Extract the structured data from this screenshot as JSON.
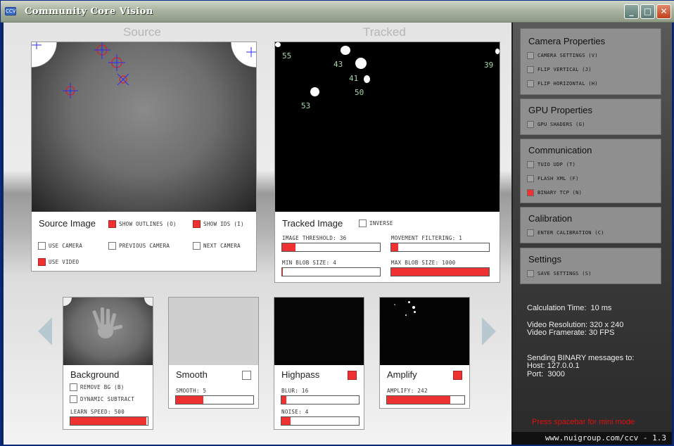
{
  "window": {
    "title": "Community Core Vision",
    "app_icon_text": "CCV",
    "buttons": {
      "minimize": "_",
      "maximize": "□",
      "close": "✕"
    }
  },
  "columns": {
    "source": "Source",
    "tracked": "Tracked"
  },
  "source_panel": {
    "title": "Source Image",
    "show_outlines": {
      "label": "Show Outlines (O)",
      "checked": true
    },
    "show_ids": {
      "label": "Show IDs (I)",
      "checked": true
    },
    "use_camera": {
      "label": "Use Camera",
      "checked": false
    },
    "previous_camera": {
      "label": "Previous Camera",
      "checked": false
    },
    "next_camera": {
      "label": "Next Camera",
      "checked": false
    },
    "use_video": {
      "label": "Use Video",
      "checked": true
    }
  },
  "tracked_panel": {
    "title": "Tracked Image",
    "inverse": {
      "label": "Inverse",
      "checked": false
    },
    "blob_ids": [
      "55",
      "43",
      "41",
      "50",
      "53",
      "39"
    ],
    "sliders": {
      "image_threshold": {
        "label": "Image Threshold: 36",
        "fraction": 0.14
      },
      "movement_filtering": {
        "label": "Movement Filtering: 1",
        "fraction": 0.07
      },
      "min_blob_size": {
        "label": "Min Blob Size: 4",
        "fraction": 0.01
      },
      "max_blob_size": {
        "label": "Max Blob Size: 1000",
        "fraction": 1.0
      }
    }
  },
  "filters": {
    "background": {
      "title": "Background",
      "remove_bg": {
        "label": "Remove BG (B)",
        "checked": false
      },
      "dynamic_subtract": {
        "label": "Dynamic Subtract",
        "checked": false
      },
      "learn_speed": {
        "label": "Learn Speed: 500",
        "fraction": 0.98
      }
    },
    "smooth": {
      "title": "Smooth",
      "enabled": false,
      "smooth": {
        "label": "Smooth: 5",
        "fraction": 0.35
      }
    },
    "highpass": {
      "title": "Highpass",
      "enabled": true,
      "blur": {
        "label": "Blur: 16",
        "fraction": 0.06
      },
      "noise": {
        "label": "Noise: 4",
        "fraction": 0.12
      }
    },
    "amplify": {
      "title": "Amplify",
      "enabled": true,
      "amplify": {
        "label": "Amplify: 242",
        "fraction": 0.82
      }
    }
  },
  "sidebar": {
    "camera": {
      "title": "Camera Properties",
      "items": [
        {
          "label": "Camera Settings (V)",
          "checked": false
        },
        {
          "label": "Flip Vertical (J)",
          "checked": false
        },
        {
          "label": "Flip Horizontal (H)",
          "checked": false
        }
      ]
    },
    "gpu": {
      "title": "GPU Properties",
      "items": [
        {
          "label": "GPU Shaders (G)",
          "checked": false
        }
      ]
    },
    "communication": {
      "title": "Communication",
      "items": [
        {
          "label": "TUIO UDP (T)",
          "checked": false
        },
        {
          "label": "Flash XML (F)",
          "checked": false
        },
        {
          "label": "Binary TCP (N)",
          "checked": true
        }
      ]
    },
    "calibration": {
      "title": "Calibration",
      "items": [
        {
          "label": "Enter Calibration (C)",
          "checked": false
        }
      ]
    },
    "settings": {
      "title": "Settings",
      "items": [
        {
          "label": "Save Settings (S)",
          "checked": false
        }
      ]
    }
  },
  "info": {
    "calc_time": "Calculation Time:  10 ms",
    "video_resolution": "Video Resolution: 320 x 240",
    "video_framerate": "Video Framerate: 30 FPS",
    "sending": "Sending BINARY messages to:",
    "host": "Host: 127.0.0.1",
    "port": "Port:  3000",
    "mini_mode_hint": "Press spacebar for mini mode"
  },
  "footer": "www.nuigroup.com/ccv - 1.3",
  "icons": {
    "prev_arrow": "arrow-left-icon",
    "next_arrow": "arrow-right-icon"
  },
  "colors": {
    "accent_red": "#ee3131",
    "hint_red": "#dd1111",
    "id_green": "#a6d6a6"
  }
}
